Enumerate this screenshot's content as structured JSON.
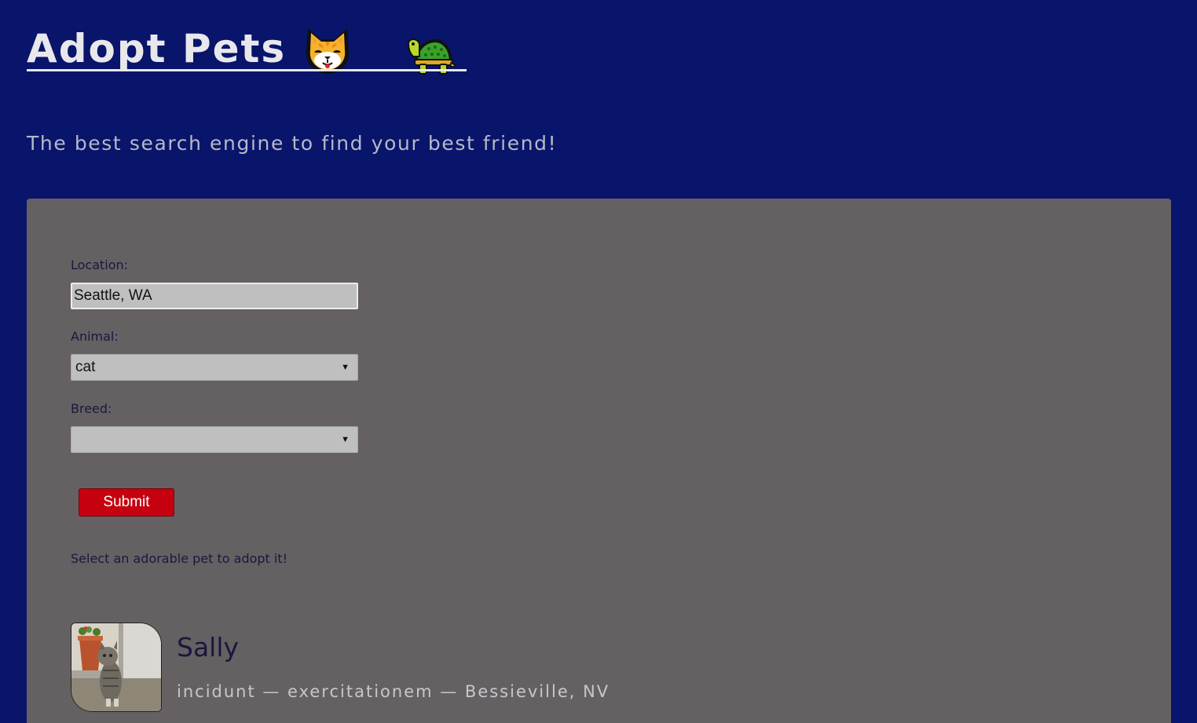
{
  "header": {
    "title": "Adopt Pets",
    "icons": [
      "cat-face-icon",
      "turtle-icon"
    ]
  },
  "tagline": "The best search engine to find your best friend!",
  "search_form": {
    "location_label": "Location:",
    "location_value": "Seattle, WA",
    "animal_label": "Animal:",
    "animal_selected": "cat",
    "breed_label": "Breed:",
    "breed_selected": "",
    "submit_label": "Submit"
  },
  "results": {
    "hint": "Select an adorable pet to adopt it!",
    "pets": [
      {
        "name": "Sally",
        "breed": "incidunt",
        "category": "exercitationem",
        "location": "Bessieville, NV",
        "details": "incidunt — exercitationem — Bessieville, NV",
        "image": "cat-photo"
      }
    ]
  },
  "colors": {
    "page_background": "#09146b",
    "panel_background": "#656163",
    "submit_button": "#c5000f",
    "label_text": "#1c163d"
  }
}
